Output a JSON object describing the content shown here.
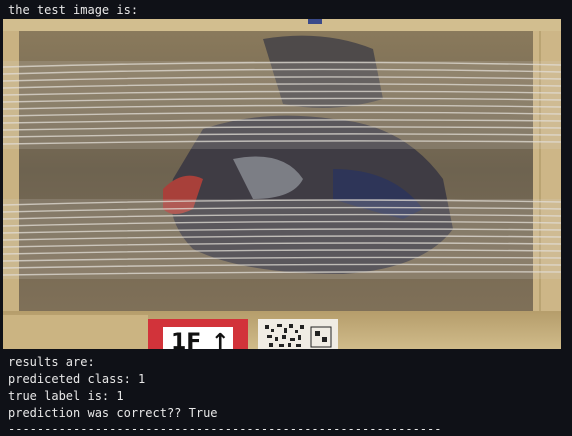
{
  "output": {
    "header": "the test image is:",
    "image_label": {
      "code": "1F",
      "arrow": "↑"
    },
    "results_heading": "results are:",
    "predicted_class": "prediceted class: 1",
    "true_label": "true label is: 1",
    "prediction_correct": "prediction was correct?? True",
    "separator": "------------------------------------------------------------"
  }
}
